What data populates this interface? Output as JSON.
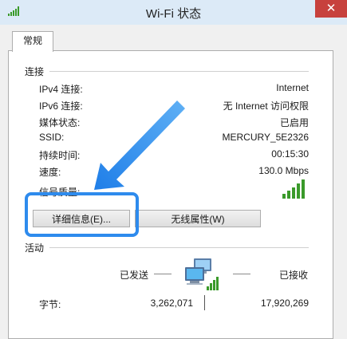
{
  "window": {
    "title": "Wi-Fi 状态",
    "close_label": "✕"
  },
  "tab": {
    "label": "常规"
  },
  "connection": {
    "group_label": "连接",
    "rows": [
      {
        "label": "IPv4 连接:",
        "value": "Internet"
      },
      {
        "label": "IPv6 连接:",
        "value": "无 Internet 访问权限"
      },
      {
        "label": "媒体状态:",
        "value": "已启用"
      },
      {
        "label": "SSID:",
        "value": "MERCURY_5E2326"
      },
      {
        "label": "持续时间:",
        "value": "00:15:30"
      },
      {
        "label": "速度:",
        "value": "130.0 Mbps"
      }
    ],
    "signal_label": "信号质量:",
    "details_button": "详细信息(E)...",
    "wireless_props_button": "无线属性(W)"
  },
  "activity": {
    "group_label": "活动",
    "sent_label": "已发送",
    "received_label": "已接收",
    "bytes_label": "字节:",
    "bytes_sent": "3,262,071",
    "bytes_received": "17,920,269"
  },
  "colors": {
    "accent": "#2e8bed",
    "signal": "#3a9a2a",
    "close": "#c7413d"
  }
}
